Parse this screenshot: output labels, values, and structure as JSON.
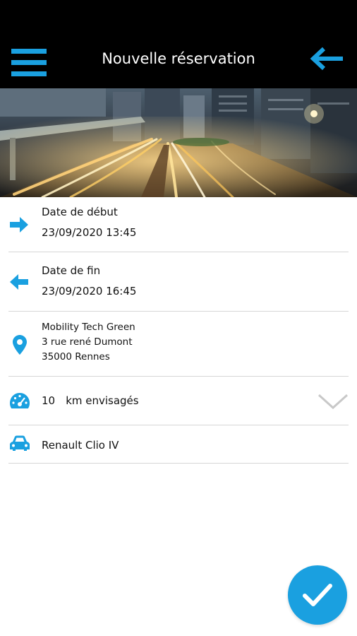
{
  "header": {
    "title": "Nouvelle réservation"
  },
  "reservation": {
    "start": {
      "label": "Date de début",
      "value": "23/09/2020 13:45"
    },
    "end": {
      "label": "Date de fin",
      "value": "23/09/2020 16:45"
    },
    "location": {
      "name": "Mobility Tech Green",
      "street": "3 rue rené Dumont",
      "city": "35000 Rennes"
    },
    "distance": {
      "value": "10",
      "unit": "km envisagés"
    },
    "vehicle": {
      "label": "Renault Clio IV"
    }
  },
  "icons": {
    "menu": "menu-icon",
    "back": "arrow-left-icon",
    "start": "arrow-right-icon",
    "end": "arrow-left-icon",
    "location": "map-pin-icon",
    "distance": "speedometer-icon",
    "dropdown": "chevron-down-icon",
    "vehicle": "car-icon",
    "confirm": "check-icon"
  },
  "colors": {
    "accent": "#1aa0e0",
    "appbar": "#000000",
    "divider": "#d6d6d6"
  }
}
